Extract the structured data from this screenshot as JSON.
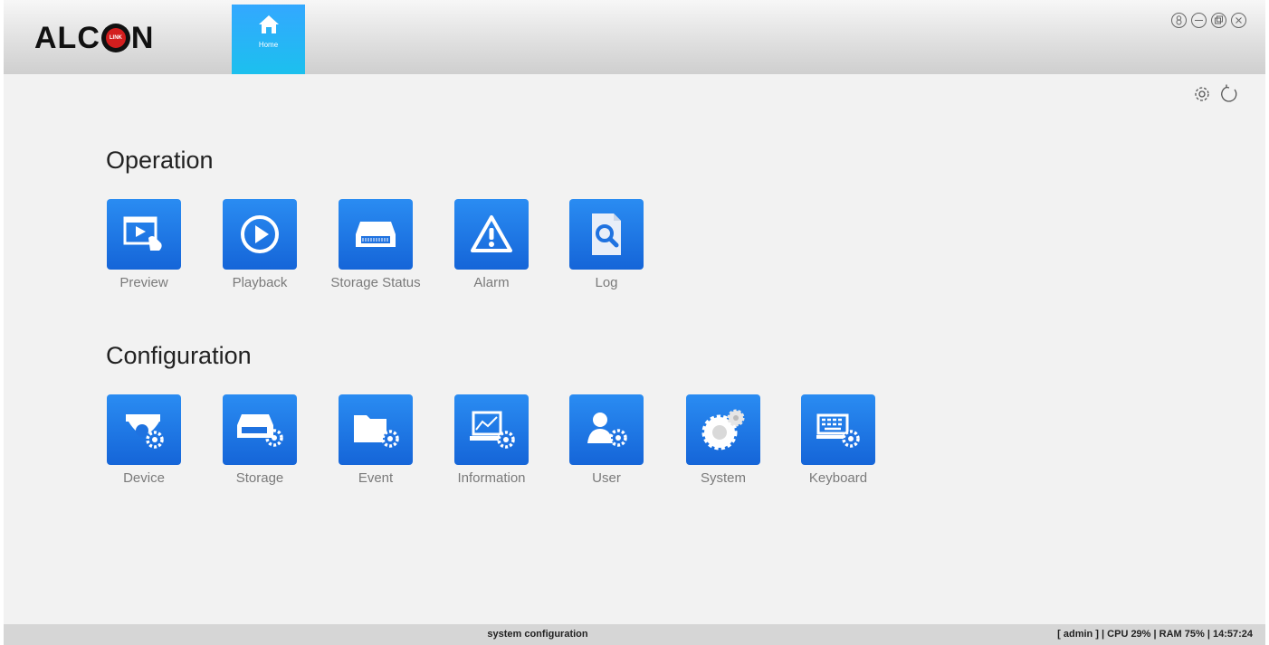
{
  "brand": {
    "logo_left": "ALC",
    "logo_badge": "LINK",
    "logo_right": "N"
  },
  "home_tab": {
    "label": "Home",
    "icon": "home-icon"
  },
  "window_controls": [
    "lock-icon",
    "minimize-icon",
    "restore-icon",
    "close-icon"
  ],
  "toolbar_icons": [
    "settings-icon",
    "refresh-icon"
  ],
  "operation": {
    "title": "Operation",
    "items": [
      {
        "label": "Preview",
        "icon": "preview-icon"
      },
      {
        "label": "Playback",
        "icon": "play-icon"
      },
      {
        "label": "Storage Status",
        "icon": "hdd-icon"
      },
      {
        "label": "Alarm",
        "icon": "warning-icon"
      },
      {
        "label": "Log",
        "icon": "log-search-icon"
      }
    ]
  },
  "configuration": {
    "title": "Configuration",
    "items": [
      {
        "label": "Device",
        "icon": "camera-gear-icon"
      },
      {
        "label": "Storage",
        "icon": "hdd-gear-icon"
      },
      {
        "label": "Event",
        "icon": "folder-gear-icon"
      },
      {
        "label": "Information",
        "icon": "chart-gear-icon"
      },
      {
        "label": "User",
        "icon": "user-gear-icon"
      },
      {
        "label": "System",
        "icon": "gears-icon"
      },
      {
        "label": "Keyboard",
        "icon": "keyboard-gear-icon"
      }
    ]
  },
  "status": {
    "center_text": "system configuration",
    "right_text": "[ admin ] | CPU  29% | RAM  75% | 14:57:24"
  },
  "colors": {
    "tile_blue": "#1f7ae6",
    "home_tab": "#2bb2f5",
    "background": "#f2f2f2"
  }
}
